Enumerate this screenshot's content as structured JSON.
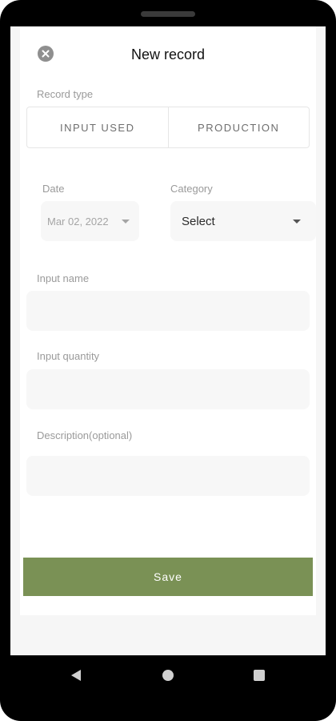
{
  "header": {
    "title": "New record",
    "close_icon": "close-circle-icon"
  },
  "record_type": {
    "label": "Record type",
    "options": [
      "INPUT USED",
      "PRODUCTION"
    ]
  },
  "date": {
    "label": "Date",
    "value": "Mar 02, 2022"
  },
  "category": {
    "label": "Category",
    "value": "Select"
  },
  "input_name": {
    "label": "Input name",
    "value": ""
  },
  "input_quantity": {
    "label": "Input quantity",
    "value": ""
  },
  "description": {
    "label": "Description(optional)",
    "value": ""
  },
  "save_label": "Save",
  "colors": {
    "save_button": "#7a9155",
    "field_background": "#f7f7f7",
    "label": "#9a9a9a"
  },
  "navbar": {
    "back_icon": "back-triangle-icon",
    "home_icon": "home-circle-icon",
    "recent_icon": "recent-apps-square-icon"
  }
}
